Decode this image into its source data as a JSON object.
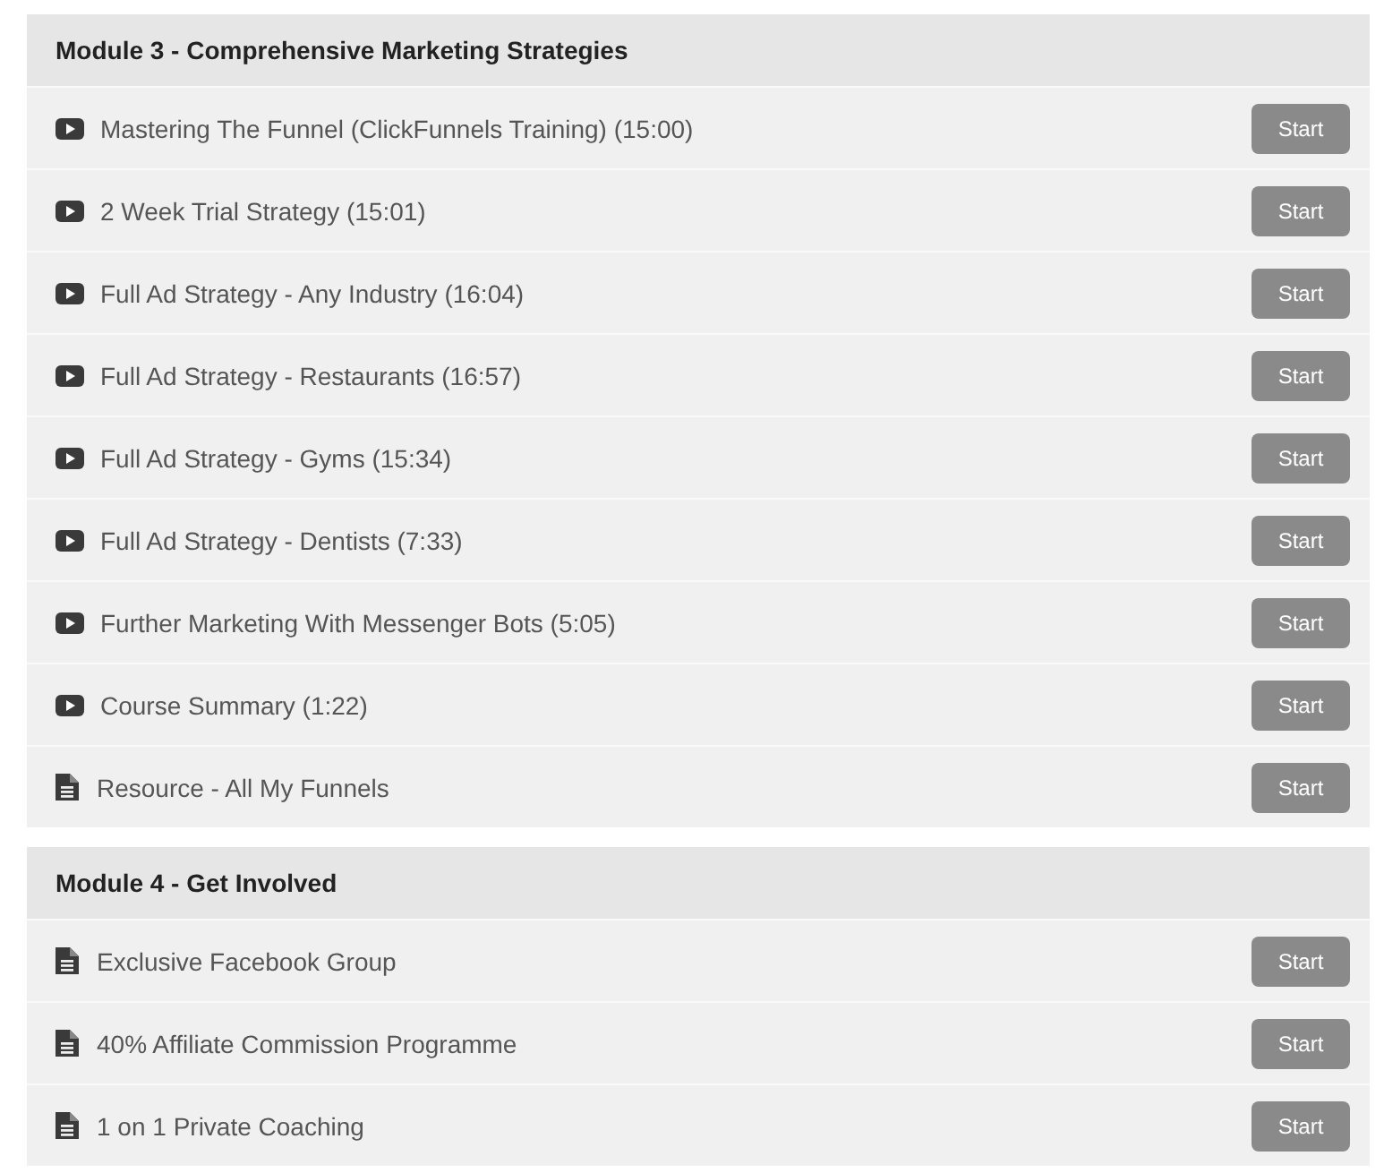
{
  "modules": [
    {
      "title": "Module 3 - Comprehensive Marketing Strategies",
      "lessons": [
        {
          "kind": "video",
          "title": "Mastering The Funnel (ClickFunnels Training) (15:00)",
          "button": "Start"
        },
        {
          "kind": "video",
          "title": "2 Week Trial Strategy (15:01)",
          "button": "Start"
        },
        {
          "kind": "video",
          "title": "Full Ad Strategy - Any Industry (16:04)",
          "button": "Start"
        },
        {
          "kind": "video",
          "title": "Full Ad Strategy - Restaurants (16:57)",
          "button": "Start"
        },
        {
          "kind": "video",
          "title": "Full Ad Strategy - Gyms (15:34)",
          "button": "Start"
        },
        {
          "kind": "video",
          "title": "Full Ad Strategy - Dentists (7:33)",
          "button": "Start"
        },
        {
          "kind": "video",
          "title": "Further Marketing With Messenger Bots (5:05)",
          "button": "Start"
        },
        {
          "kind": "video",
          "title": "Course Summary (1:22)",
          "button": "Start"
        },
        {
          "kind": "document",
          "title": "Resource - All My Funnels",
          "button": "Start"
        }
      ]
    },
    {
      "title": "Module 4 - Get Involved",
      "lessons": [
        {
          "kind": "document",
          "title": "Exclusive Facebook Group",
          "button": "Start"
        },
        {
          "kind": "document",
          "title": "40% Affiliate Commission Programme",
          "button": "Start"
        },
        {
          "kind": "document",
          "title": "1 on 1 Private Coaching",
          "button": "Start"
        }
      ]
    }
  ]
}
